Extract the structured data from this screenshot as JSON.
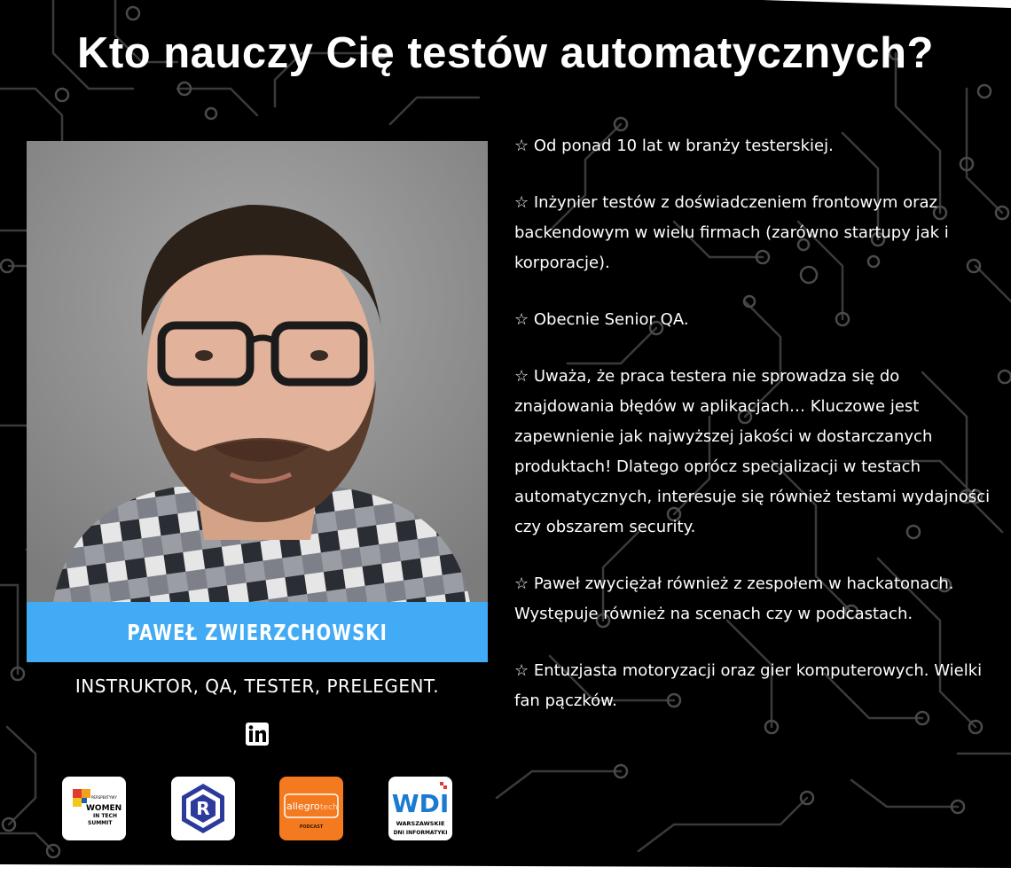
{
  "header": {
    "title": "Kto nauczy Cię testów automatycznych?"
  },
  "instructor": {
    "name": "PAWEŁ ZWIERZCHOWSKI",
    "role": "INSTRUKTOR, QA, TESTER, PRELEGENT."
  },
  "bio": [
    "☆ Od ponad 10 lat w branży testerskiej.",
    "☆ Inżynier testów z doświadczeniem frontowym oraz backendowym w wielu firmach (zarówno startupy jak i korporacje).",
    "☆ Obecnie Senior QA.",
    "☆ Uważa, że praca testera nie sprowadza się do znajdowania błędów w aplikacjach… Kluczowe jest zapewnienie jak najwyższej jakości w dostarczanych produktach! Dlatego oprócz specjalizacji w testach automatycznych, interesuje się również testami wydajności czy obszarem security.",
    "☆ Paweł zwyciężał również z zespołem w hackatonach. Występuje również na scenach czy w podcastach.",
    "☆ Entuzjasta motoryzacji oraz gier komputerowych. Wielki fan pączków."
  ],
  "logos": {
    "women_in_tech": [
      "PERSPEKTYWY",
      "WOMEN",
      "IN TECH",
      "SUMMIT"
    ],
    "allegro_tech": [
      "allegro",
      "tech",
      "PODCAST"
    ],
    "wdi": [
      "WDI",
      "WARSZAWSKIE",
      "DNI INFORMATYKI"
    ]
  },
  "colors": {
    "accent": "#42abf5",
    "background": "#000000",
    "text": "#ffffff"
  },
  "icons": {
    "social": "linkedin-icon"
  }
}
